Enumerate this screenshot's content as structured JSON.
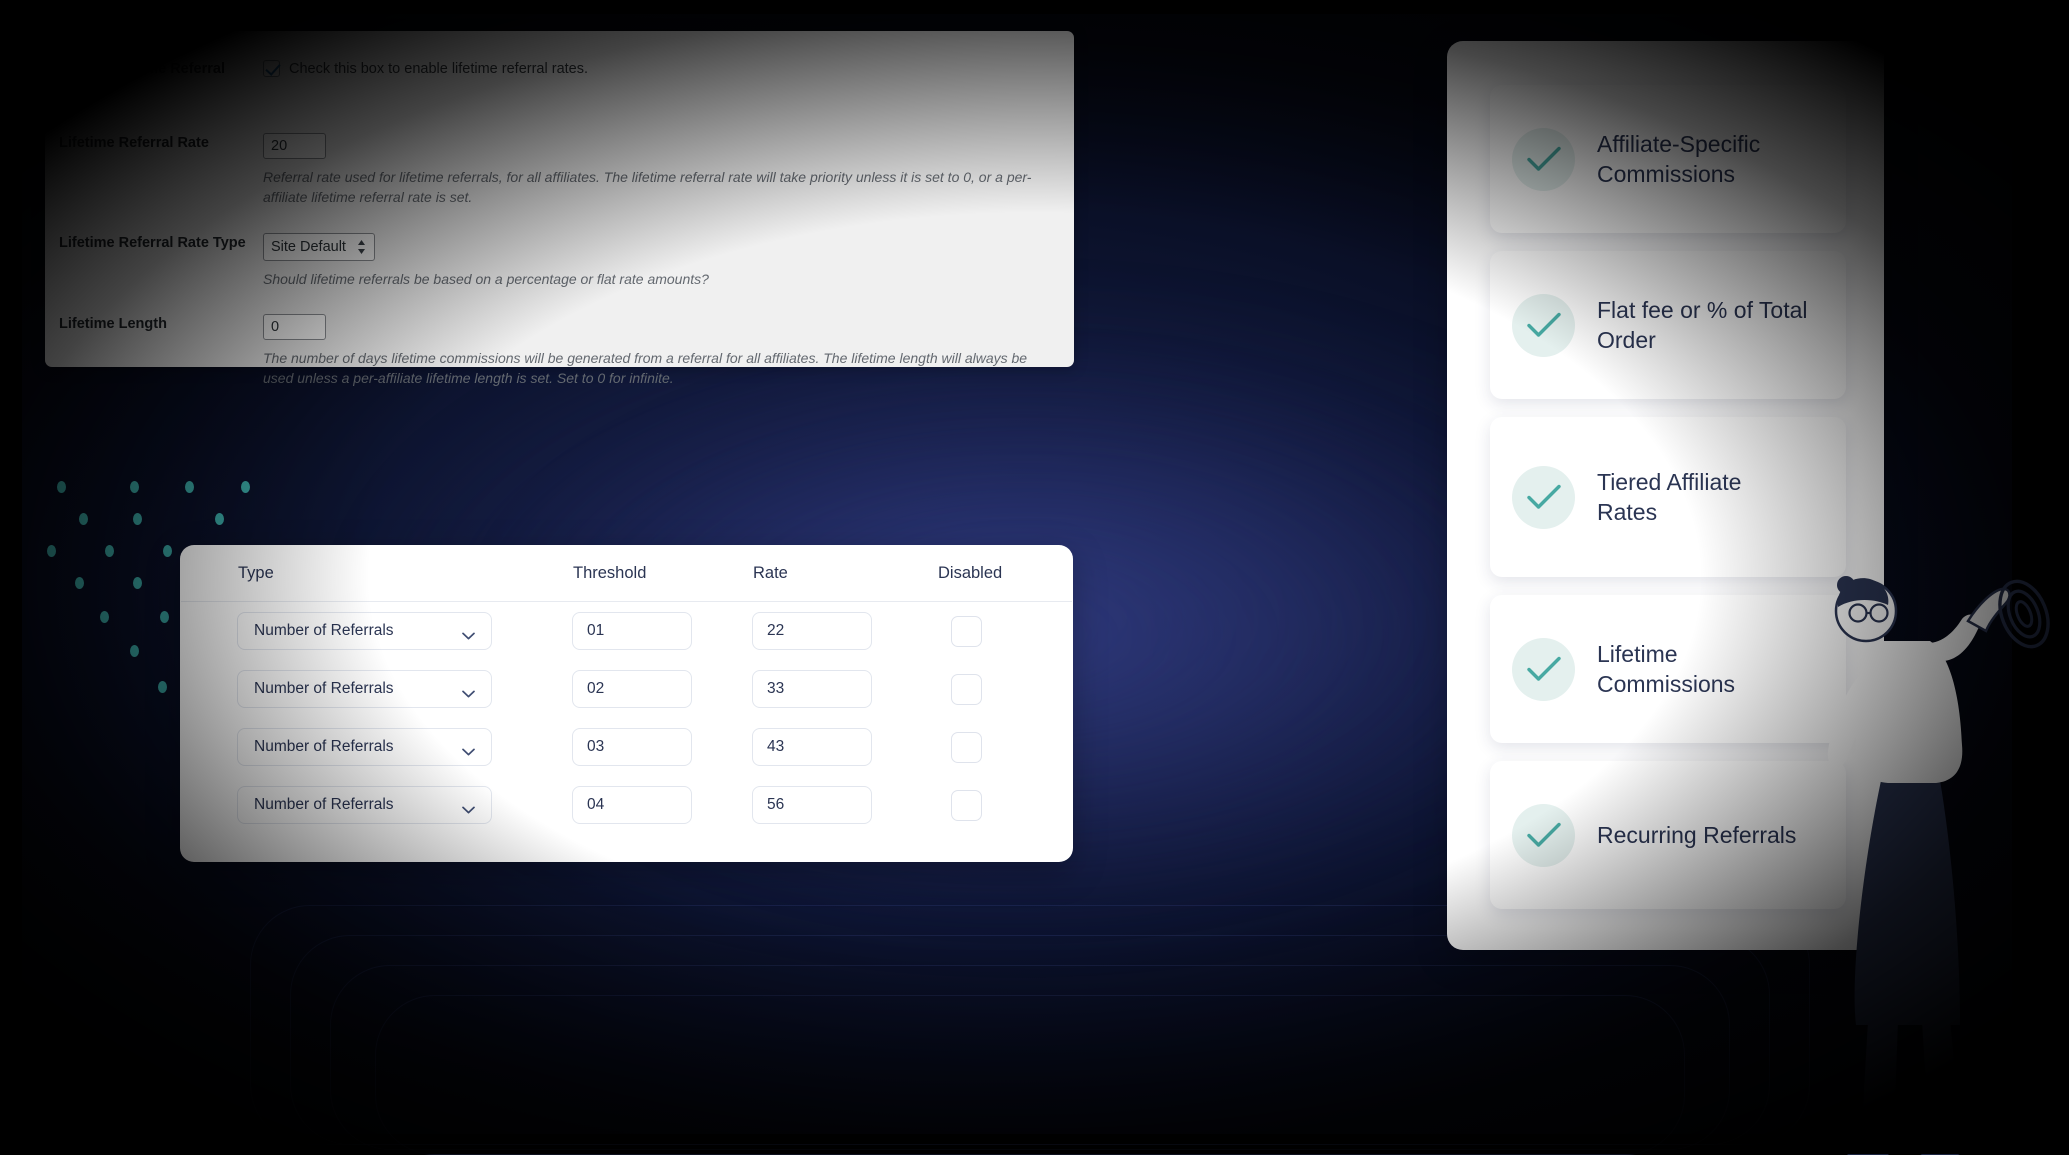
{
  "settings": {
    "fields": [
      {
        "label": "Enable Lifetime Referral Rates",
        "type": "checkbox",
        "checked": true,
        "checkbox_text": "Check this box to enable lifetime referral rates.",
        "description": ""
      },
      {
        "label": "Lifetime Referral Rate",
        "type": "text",
        "value": "20",
        "description": "Referral rate used for lifetime referrals, for all affiliates. The lifetime referral rate will take priority unless it is set to 0, or a per-affiliate lifetime referral rate is set."
      },
      {
        "label": "Lifetime Referral Rate Type",
        "type": "select",
        "value": "Site Default",
        "description": "Should lifetime referrals be based on a percentage or flat rate amounts?"
      },
      {
        "label": "Lifetime Length",
        "type": "text",
        "value": "0",
        "description": "The number of days lifetime commissions will be generated from a referral for all affiliates. The lifetime length will always be used unless a per-affiliate lifetime length is set. Set to 0 for infinite."
      }
    ]
  },
  "tier_table": {
    "columns": {
      "type": "Type",
      "threshold": "Threshold",
      "rate": "Rate",
      "disabled": "Disabled"
    },
    "rows": [
      {
        "type": "Number of Referrals",
        "threshold": "01",
        "rate": "22",
        "disabled": false
      },
      {
        "type": "Number of Referrals",
        "threshold": "02",
        "rate": "33",
        "disabled": false
      },
      {
        "type": "Number of Referrals",
        "threshold": "03",
        "rate": "43",
        "disabled": false
      },
      {
        "type": "Number of Referrals",
        "threshold": "04",
        "rate": "56",
        "disabled": false
      }
    ]
  },
  "features": {
    "items": [
      {
        "label": "Affiliate-Specific Commissions",
        "icon": "check-icon"
      },
      {
        "label": "Flat fee or % of Total Order",
        "icon": "check-icon"
      },
      {
        "label": "Tiered Affiliate Rates",
        "icon": "check-icon"
      },
      {
        "label": "Lifetime Commissions",
        "icon": "check-icon"
      },
      {
        "label": "Recurring Referrals",
        "icon": "check-icon"
      }
    ]
  },
  "colors": {
    "accent_teal": "#3fb5b0",
    "check_teal": "#47a9a2",
    "check_circle_bg": "#e4f0ee",
    "text_navy": "#2b3553",
    "panel_gray": "#f0f0f0",
    "backdrop_navy": "#111a3d",
    "wp_checkbox_blue": "#2271b1"
  }
}
